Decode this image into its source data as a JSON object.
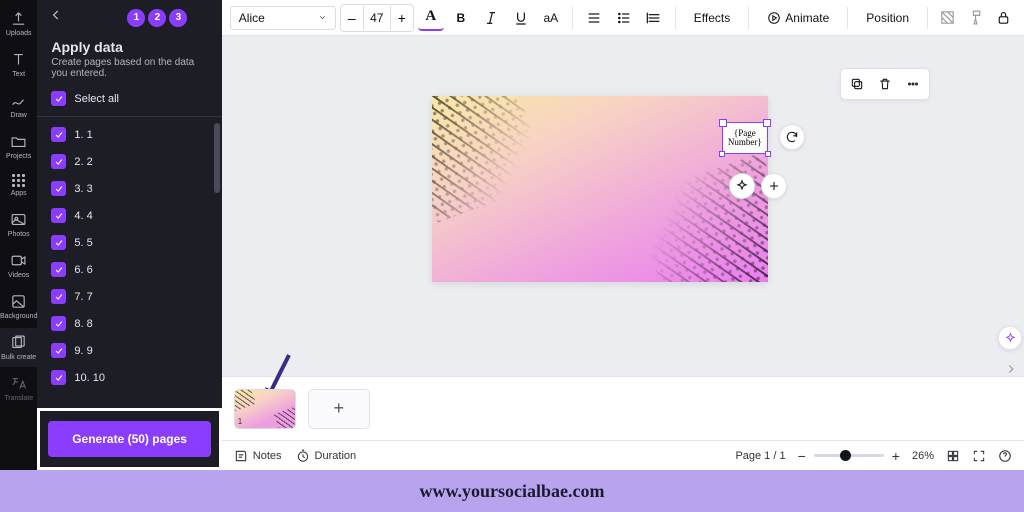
{
  "rail": {
    "uploads": "Uploads",
    "text": "Text",
    "draw": "Draw",
    "projects": "Projects",
    "apps": "Apps",
    "photos": "Photos",
    "videos": "Videos",
    "background": "Background",
    "bulk": "Bulk create",
    "translate": "Translate"
  },
  "panel": {
    "steps": [
      "1",
      "2",
      "3"
    ],
    "title": "Apply data",
    "subtitle": "Create pages based on the data you entered.",
    "select_all": "Select all",
    "rows": [
      "1. 1",
      "2. 2",
      "3. 3",
      "4. 4",
      "5. 5",
      "6. 6",
      "7. 7",
      "8. 8",
      "9. 9",
      "10. 10"
    ],
    "generate": "Generate (50) pages"
  },
  "toolbar": {
    "font": "Alice",
    "size": "47",
    "bold": "B",
    "aA": "aA",
    "effects": "Effects",
    "animate": "Animate",
    "position": "Position"
  },
  "canvas": {
    "placeholder_text": "{Page Number}"
  },
  "timeline": {
    "page_num": "1"
  },
  "bottom": {
    "notes": "Notes",
    "duration": "Duration",
    "page_indicator": "Page 1 / 1",
    "zoom": "26%"
  },
  "watermark": "www.yoursocialbae.com"
}
